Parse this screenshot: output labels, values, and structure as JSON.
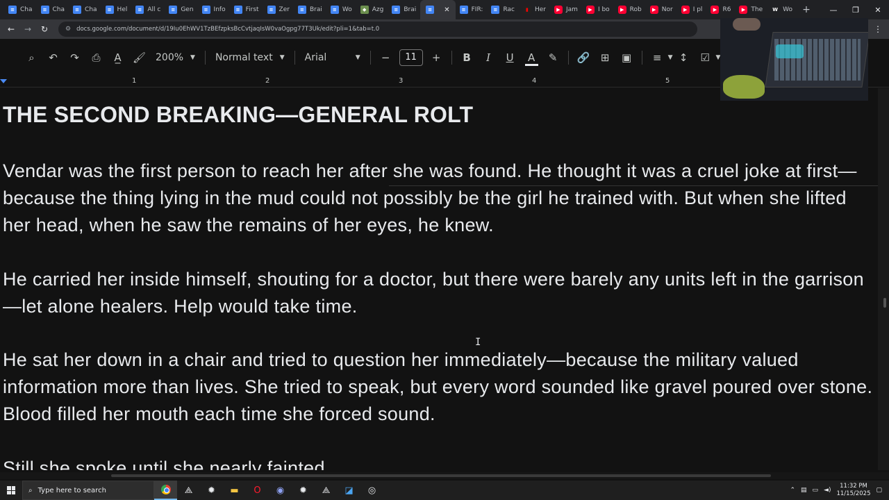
{
  "browser": {
    "tabs": [
      {
        "label": "Cha",
        "icon": "docs"
      },
      {
        "label": "Cha",
        "icon": "docs"
      },
      {
        "label": "Cha",
        "icon": "docs"
      },
      {
        "label": "Hel",
        "icon": "docs"
      },
      {
        "label": "All c",
        "icon": "docs"
      },
      {
        "label": "Gen",
        "icon": "docs"
      },
      {
        "label": "Info",
        "icon": "docs"
      },
      {
        "label": "First",
        "icon": "docs"
      },
      {
        "label": "Zer",
        "icon": "docs"
      },
      {
        "label": "Brai",
        "icon": "docs"
      },
      {
        "label": "Wo",
        "icon": "docs"
      },
      {
        "label": "Azg",
        "icon": "azg"
      },
      {
        "label": "Brai",
        "icon": "docs"
      },
      {
        "label": "",
        "icon": "docs",
        "active": true
      },
      {
        "label": "FIR:",
        "icon": "docs"
      },
      {
        "label": "Rac",
        "icon": "docs"
      },
      {
        "label": "Her",
        "icon": "m"
      },
      {
        "label": "Jam",
        "icon": "youtube"
      },
      {
        "label": "I bo",
        "icon": "youtube"
      },
      {
        "label": "Rob",
        "icon": "youtube"
      },
      {
        "label": "Nor",
        "icon": "youtube"
      },
      {
        "label": "I pl",
        "icon": "youtube"
      },
      {
        "label": "R6",
        "icon": "youtube"
      },
      {
        "label": "The",
        "icon": "youtube"
      },
      {
        "label": "Wo",
        "icon": "w"
      }
    ],
    "url": "docs.google.com/document/d/19Iu0EhWV1TzBEfzpksBcCvtjaqIsW0vaOgpg77T3Uk/edit?pli=1&tab=t.0"
  },
  "toolbar": {
    "zoom": "200%",
    "style": "Normal text",
    "font": "Arial",
    "font_size": "11"
  },
  "ruler": {
    "numbers": [
      "1",
      "2",
      "3",
      "4",
      "5"
    ]
  },
  "document": {
    "title": "THE SECOND BREAKING—GENERAL ROLT",
    "paragraphs": [
      "Vendar was the first person to reach her after she was found. He thought it was a cruel joke at first—because the thing lying in the mud could not possibly be the girl he trained with. But when she lifted her head, when he saw the remains of her eyes, he knew.",
      "He carried her inside himself, shouting for a doctor, but there were barely any units left in the garrison—let alone healers. Help would take time.",
      "He sat her down in a chair and tried to question her immediately—because the military valued information more than lives. She tried to speak, but every word sounded like gravel poured over stone. Blood filled her mouth each time she forced sound.",
      "Still she spoke until she nearly fainted."
    ]
  },
  "taskbar": {
    "search_placeholder": "Type here to search",
    "time": "11:32 PM",
    "date": "11/15/2025"
  }
}
